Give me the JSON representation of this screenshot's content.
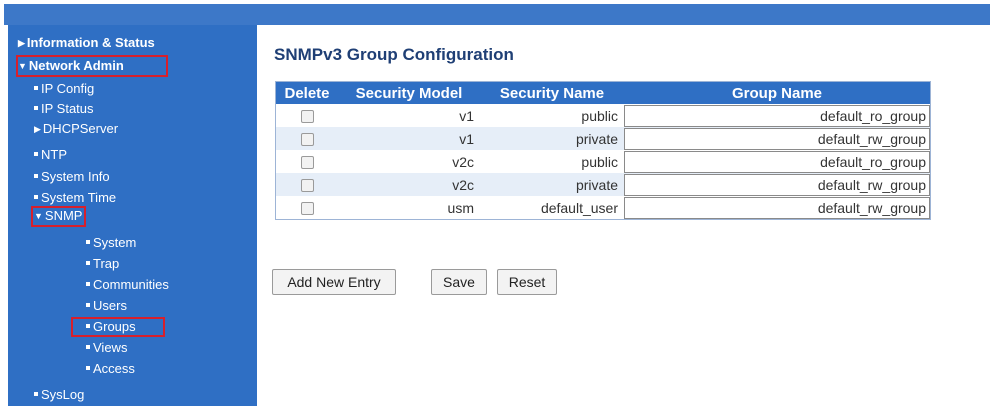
{
  "colors": {
    "sidebar_bg": "#2f6fc4",
    "header_bg": "#2f6fc4",
    "title": "#1f3f75",
    "highlight_border": "#d8202c",
    "row_alt": "#e6eef8"
  },
  "sidebar": {
    "items": [
      {
        "label": "Information & Status",
        "icon": "triangle-right-icon"
      },
      {
        "label": "Network Admin",
        "icon": "triangle-down-icon",
        "highlighted": true
      },
      {
        "label": "IP Config",
        "icon": "bullet-icon"
      },
      {
        "label": "IP Status",
        "icon": "bullet-icon"
      },
      {
        "label": "DHCPServer",
        "icon": "triangle-right-icon"
      },
      {
        "label": "NTP",
        "icon": "bullet-icon"
      },
      {
        "label": "System Info",
        "icon": "bullet-icon"
      },
      {
        "label": "System Time",
        "icon": "bullet-icon"
      },
      {
        "label": "SNMP",
        "icon": "triangle-down-icon",
        "highlighted": true
      },
      {
        "label": "System",
        "icon": "bullet-icon"
      },
      {
        "label": "Trap",
        "icon": "bullet-icon"
      },
      {
        "label": "Communities",
        "icon": "bullet-icon"
      },
      {
        "label": "Users",
        "icon": "bullet-icon"
      },
      {
        "label": "Groups",
        "icon": "bullet-icon",
        "highlighted": true
      },
      {
        "label": "Views",
        "icon": "bullet-icon"
      },
      {
        "label": "Access",
        "icon": "bullet-icon"
      },
      {
        "label": "SysLog",
        "icon": "bullet-icon"
      }
    ]
  },
  "main": {
    "title": "SNMPv3 Group Configuration",
    "table": {
      "headers": [
        "Delete",
        "Security Model",
        "Security Name",
        "Group Name"
      ],
      "rows": [
        {
          "security_model": "v1",
          "security_name": "public",
          "group_name": "default_ro_group"
        },
        {
          "security_model": "v1",
          "security_name": "private",
          "group_name": "default_rw_group"
        },
        {
          "security_model": "v2c",
          "security_name": "public",
          "group_name": "default_ro_group"
        },
        {
          "security_model": "v2c",
          "security_name": "private",
          "group_name": "default_rw_group"
        },
        {
          "security_model": "usm",
          "security_name": "default_user",
          "group_name": "default_rw_group"
        }
      ]
    },
    "buttons": {
      "add_new_entry": "Add New Entry",
      "save": "Save",
      "reset": "Reset"
    }
  }
}
